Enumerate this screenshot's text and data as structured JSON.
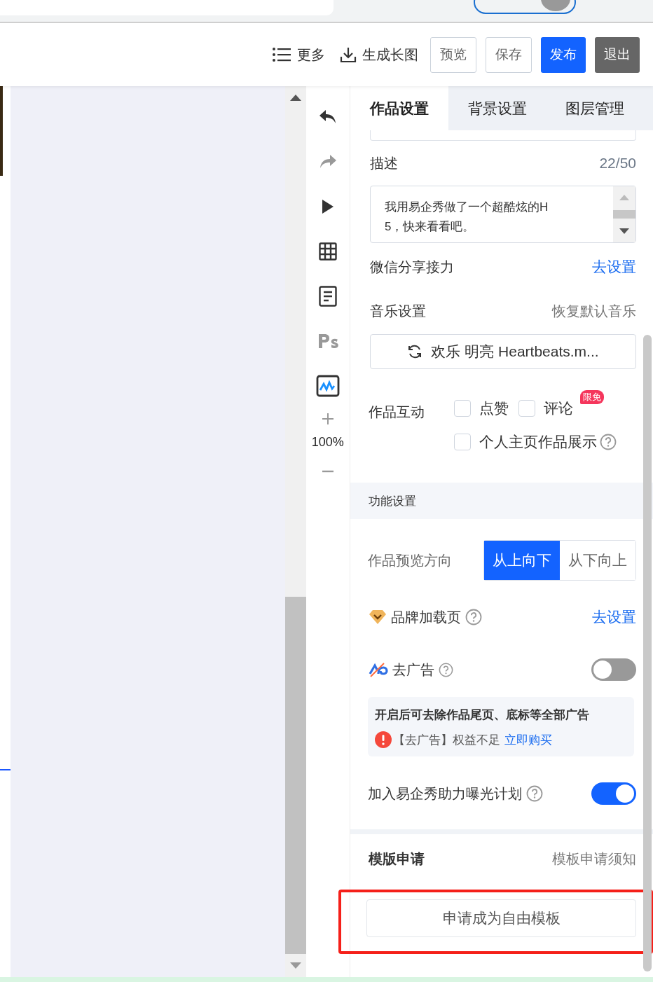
{
  "toolbar": {
    "actions": [
      {
        "kind": "more",
        "label": "更多"
      },
      {
        "kind": "download",
        "label": "生成长图"
      }
    ],
    "buttons": [
      {
        "kind": "outline",
        "label": "预览"
      },
      {
        "kind": "outline",
        "label": "保存"
      },
      {
        "kind": "primary",
        "label": "发布"
      },
      {
        "kind": "dark",
        "label": "退出"
      }
    ]
  },
  "tools": [
    {
      "kind": "undo",
      "disabled": false
    },
    {
      "kind": "redo",
      "disabled": true
    },
    {
      "kind": "play",
      "disabled": false
    },
    {
      "kind": "grid",
      "disabled": false
    },
    {
      "kind": "document",
      "disabled": false
    },
    {
      "kind": "ps",
      "disabled": true
    },
    {
      "kind": "chart",
      "disabled": false
    }
  ],
  "zoom": {
    "value": "100%"
  },
  "panel": {
    "tabs": [
      {
        "label": "作品设置",
        "selected": true
      },
      {
        "label": "背景设置",
        "selected": false
      },
      {
        "label": "图层管理",
        "selected": false
      }
    ],
    "description": {
      "label": "描述",
      "counter": "22/50",
      "value": "我用易企秀做了一个超酷炫的H5，快来看看吧。"
    },
    "wechat": {
      "label": "微信分享接力",
      "link": "去设置"
    },
    "music": {
      "label": "音乐设置",
      "reset": "恢复默认音乐",
      "track": "欢乐 明亮 Heartbeats.m..."
    },
    "interaction": {
      "label": "作品互动",
      "options": [
        {
          "label": "点赞",
          "checked": false
        },
        {
          "label": "评论",
          "checked": false,
          "badge": "限免"
        },
        {
          "label": "个人主页作品展示",
          "checked": false,
          "help": true
        }
      ]
    },
    "section_title": "功能设置",
    "direction": {
      "label": "作品预览方向",
      "options": [
        {
          "label": "从上向下",
          "selected": true
        },
        {
          "label": "从下向上",
          "selected": false
        }
      ]
    },
    "brand": {
      "label": "品牌加载页",
      "link": "去设置"
    },
    "ad": {
      "label": "去广告",
      "on": false,
      "note_title": "开启后可去除作品尾页、底标等全部广告",
      "warning": "【去广告】权益不足",
      "buy_link": "立即购买"
    },
    "exposure": {
      "label": "加入易企秀助力曝光计划",
      "on": true
    },
    "template": {
      "title": "模版申请",
      "link": "模板申请须知",
      "button": "申请成为自由模板"
    }
  }
}
